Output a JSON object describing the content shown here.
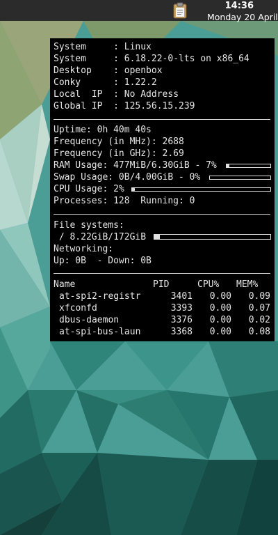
{
  "topbar": {
    "clipboard_icon": "clipboard-icon",
    "time": "14:36",
    "date": "Monday 20 April"
  },
  "conky": {
    "system_info": [
      {
        "label": "System     : ",
        "value": "Linux"
      },
      {
        "label": "System     : ",
        "value": "6.18.22-0-lts on x86_64"
      },
      {
        "label": "Desktop    : ",
        "value": "openbox"
      },
      {
        "label": "Conky      : ",
        "value": "1.22.2"
      },
      {
        "label": "Local  IP  : ",
        "value": "No Address"
      },
      {
        "label": "Global IP  : ",
        "value": "125.56.15.239"
      }
    ],
    "uptime": "Uptime: 0h 40m 40s",
    "freq_mhz": "Frequency (in MHz): 2688",
    "freq_ghz": "Frequency (in GHz): 2.69",
    "ram": {
      "text": "RAM Usage: 477MiB/6.30GiB - 7%",
      "percent": 7
    },
    "swap": {
      "text": "Swap Usage: 0B/4.00GiB - 0%",
      "percent": 0
    },
    "cpu": {
      "text": "CPU Usage: 2%",
      "percent": 2
    },
    "processes": "Processes: 128  Running: 0",
    "filesystems_heading": "File systems:",
    "filesystem": {
      "text": " / 8.22GiB/172GiB",
      "percent": 5
    },
    "networking_heading": "Networking:",
    "network": "Up: 0B  - Down: 0B",
    "process_table": {
      "headers": [
        "Name",
        "PID",
        "CPU%",
        "MEM%"
      ],
      "rows": [
        [
          "at-spi2-registr",
          "3401",
          "0.00",
          "0.09"
        ],
        [
          "xfconfd",
          "3393",
          "0.00",
          "0.07"
        ],
        [
          "dbus-daemon",
          "3376",
          "0.00",
          "0.02"
        ],
        [
          "at-spi-bus-laun",
          "3368",
          "0.00",
          "0.08"
        ]
      ]
    }
  }
}
